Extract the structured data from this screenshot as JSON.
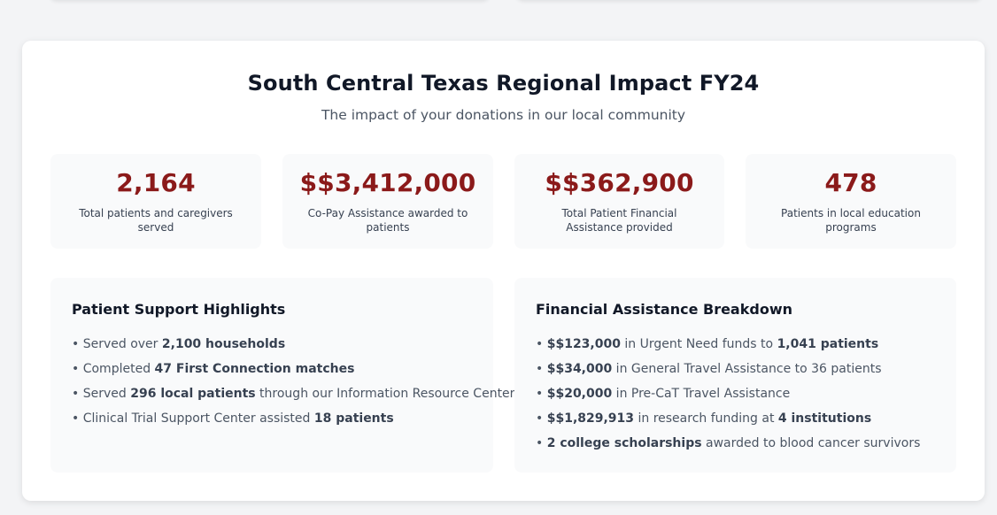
{
  "header": {
    "title": "South Central Texas Regional Impact FY24",
    "subtitle": "The impact of your donations in our local community"
  },
  "stats": [
    {
      "value": "2,164",
      "label": "Total patients and caregivers served"
    },
    {
      "value": "$$3,412,000",
      "label": "Co-Pay Assistance awarded to patients"
    },
    {
      "value": "$$362,900",
      "label": "Total Patient Financial Assistance provided"
    },
    {
      "value": "478",
      "label": "Patients in local education programs"
    }
  ],
  "patient_support": {
    "title": "Patient Support Highlights",
    "items": [
      {
        "pre": "Served over ",
        "bold": "2,100 households",
        "post": ""
      },
      {
        "pre": "Completed ",
        "bold": "47 First Connection matches",
        "post": ""
      },
      {
        "pre": "Served ",
        "bold": "296 local patients",
        "post": " through our Information Resource Center"
      },
      {
        "pre": "Clinical Trial Support Center assisted ",
        "bold": "18 patients",
        "post": ""
      }
    ]
  },
  "financial": {
    "title": "Financial Assistance Breakdown",
    "items": [
      {
        "pre": "",
        "bold": "$$123,000",
        "mid": " in Urgent Need funds to ",
        "bold2": "1,041 patients",
        "post": ""
      },
      {
        "pre": "",
        "bold": "$$34,000",
        "mid": " in General Travel Assistance to 36 patients",
        "bold2": "",
        "post": ""
      },
      {
        "pre": "",
        "bold": "$$20,000",
        "mid": " in Pre-CaT Travel Assistance",
        "bold2": "",
        "post": ""
      },
      {
        "pre": "",
        "bold": "$$1,829,913",
        "mid": " in research funding at ",
        "bold2": "4 institutions",
        "post": ""
      },
      {
        "pre": "",
        "bold": "2 college scholarships",
        "mid": " awarded to blood cancer survivors",
        "bold2": "",
        "post": ""
      }
    ]
  },
  "colors": {
    "accent": "#8b1a1a",
    "card_bg": "#f9fafb",
    "page_bg": "#f3f4f6"
  }
}
